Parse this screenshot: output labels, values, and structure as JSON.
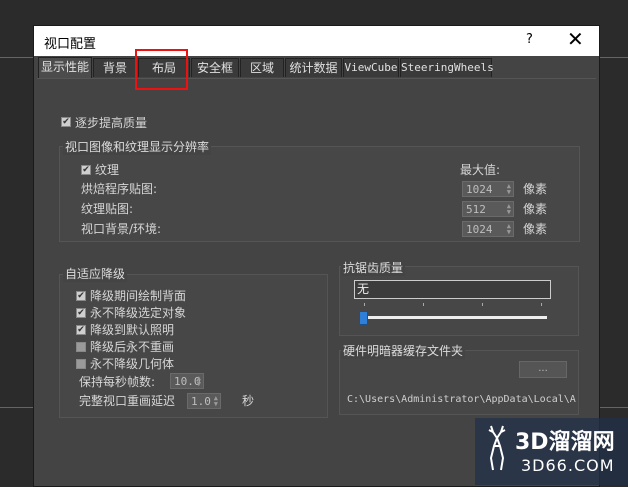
{
  "window": {
    "title": "视口配置",
    "help": "?",
    "close": "✕"
  },
  "tabs": [
    {
      "label": "显示性能",
      "active": true
    },
    {
      "label": "背景",
      "active": false
    },
    {
      "label": "布局",
      "active": false
    },
    {
      "label": "安全框",
      "active": false
    },
    {
      "label": "区域",
      "active": false
    },
    {
      "label": "统计数据",
      "active": false
    },
    {
      "label": "ViewCube",
      "active": false
    },
    {
      "label": "SteeringWheels",
      "active": false
    }
  ],
  "progressive": {
    "label": "逐步提高质量",
    "checked": true
  },
  "resolution": {
    "title": "视口图像和纹理显示分辨率",
    "texture_label": "纹理",
    "texture_checked": true,
    "max_label": "最大值:",
    "unit": "像素",
    "rows": [
      {
        "label": "烘焙程序贴图:",
        "value": "1024"
      },
      {
        "label": "纹理贴图:",
        "value": "512"
      },
      {
        "label": "视口背景/环境:",
        "value": "1024"
      }
    ]
  },
  "adaptive": {
    "title": "自适应降级",
    "options": [
      {
        "label": "降级期间绘制背面",
        "checked": true
      },
      {
        "label": "永不降级选定对象",
        "checked": true
      },
      {
        "label": "降级到默认照明",
        "checked": true
      },
      {
        "label": "降级后永不重画",
        "checked": false
      },
      {
        "label": "永不降级几何体",
        "checked": false
      }
    ],
    "fps_label": "保持每秒帧数:",
    "fps_value": "10.0",
    "delay_label": "完整视口重画延迟",
    "delay_value": "1.0",
    "delay_unit": "秒"
  },
  "antialias": {
    "title": "抗锯齿质量",
    "value": "无",
    "slider_level": 0
  },
  "cache": {
    "title": "硬件明暗器缓存文件夹",
    "browse_label": "...",
    "path": "C:\\Users\\Administrator\\AppData\\Local\\A"
  },
  "watermark": {
    "text1": "3D溜溜网",
    "text2": "3D66.COM"
  },
  "colors": {
    "highlight": "#e11111",
    "slider": "#2f7ed8",
    "background": "#444444"
  }
}
